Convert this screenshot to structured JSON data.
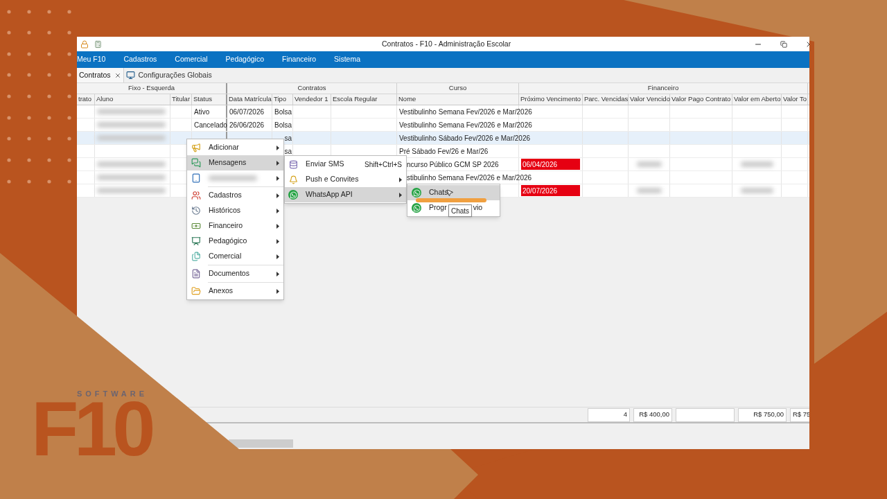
{
  "window": {
    "title": "Contratos - F10 - Administração Escolar"
  },
  "menu_bar": [
    "Meu F10",
    "Cadastros",
    "Comercial",
    "Pedagógico",
    "Financeiro",
    "Sistema"
  ],
  "tabs": [
    {
      "label": "Contratos",
      "selected": true,
      "closable": true
    },
    {
      "label": "Configurações Globais",
      "selected": false,
      "closable": false
    }
  ],
  "table": {
    "groups": [
      {
        "label": "Fixo - Esquerda",
        "columns": [
          "trato",
          "Aluno",
          "Titular",
          "Status"
        ]
      },
      {
        "label": "Contratos",
        "columns": [
          "Data Matrícula",
          "Tipo",
          "Vendedor 1",
          "Escola Regular"
        ]
      },
      {
        "label": "Curso",
        "columns": [
          "Nome"
        ]
      },
      {
        "label": "Financeiro",
        "columns": [
          "Próximo Vencimento",
          "Parc. Vencidas",
          "Valor Vencido",
          "Valor Pago Contrato",
          "Valor em Aberto",
          "Valor To"
        ]
      }
    ],
    "rows": [
      {
        "selected": false,
        "aluno_blurred": true,
        "status": "Ativo",
        "data_matricula": "06/07/2026",
        "tipo": "Bolsa",
        "nome": "Vestibulinho Semana Fev/2026 e Mar/2026"
      },
      {
        "selected": false,
        "aluno_blurred": true,
        "status": "Cancelado",
        "data_matricula": "26/06/2026",
        "tipo": "Bolsa",
        "nome": "Vestibulinho Semana Fev/2026 e Mar/2026"
      },
      {
        "selected": true,
        "aluno_blurred": true,
        "tipo": "sa",
        "tipo_cut": true,
        "nome": "Vestibulinho Sábado Fev/2026 e Mar/2026"
      },
      {
        "selected": false,
        "aluno_blurred": false,
        "tipo": "sa",
        "tipo_cut": true,
        "nome": "Pré Sábado Fev/26 e Mar/26"
      },
      {
        "selected": false,
        "aluno_blurred": true,
        "nome": "ncurso Público GCM SP 2026",
        "nome_cut": true,
        "proximo_vencimento": "06/04/2026",
        "overdue": true,
        "values_blurred": true
      },
      {
        "selected": false,
        "aluno_blurred": true,
        "nome": "stibulinho Semana Fev/2026 e Mar/2026",
        "nome_cut": true
      },
      {
        "selected": false,
        "aluno_blurred": true,
        "proximo_vencimento": "20/07/2026",
        "overdue": true,
        "values_blurred": true
      }
    ],
    "totals": [
      {
        "kind": "value",
        "text": "4"
      },
      {
        "kind": "value",
        "text": "R$ 400,00"
      },
      {
        "kind": "empty"
      },
      {
        "kind": "value",
        "text": "R$ 750,00"
      },
      {
        "kind": "value",
        "text": "R$ 75"
      }
    ]
  },
  "context_menu": {
    "items": [
      {
        "kind": "item",
        "label": "Adicionar",
        "selected": false,
        "divider_above": false
      },
      {
        "kind": "item",
        "label": "Mensagens",
        "selected": true,
        "divider_above": false
      },
      {
        "kind": "blurred",
        "selected": false,
        "divider_above": false
      },
      {
        "kind": "item",
        "label": "Cadastros",
        "selected": false,
        "divider_above": true
      },
      {
        "kind": "item",
        "label": "Históricos",
        "selected": false,
        "divider_above": false
      },
      {
        "kind": "item",
        "label": "Financeiro",
        "selected": false,
        "divider_above": false
      },
      {
        "kind": "item",
        "label": "Pedagógico",
        "selected": false,
        "divider_above": false
      },
      {
        "kind": "item",
        "label": "Comercial",
        "selected": false,
        "divider_above": false
      },
      {
        "kind": "item",
        "label": "Documentos",
        "selected": false,
        "divider_above": true
      },
      {
        "kind": "item",
        "label": "Anexos",
        "selected": false,
        "divider_above": true
      }
    ]
  },
  "submenu": {
    "items": [
      {
        "label": "Enviar SMS",
        "shortcut": "Shift+Ctrl+S",
        "has_submenu": false,
        "selected": false
      },
      {
        "label": "Push e Convites",
        "has_submenu": true,
        "selected": false
      },
      {
        "label": "WhatsApp API",
        "has_submenu": true,
        "selected": true
      }
    ]
  },
  "whatsapp_menu": {
    "items": [
      {
        "label": "Chats",
        "selected": true
      },
      {
        "label": "Progr",
        "label_end": "vio",
        "selected": false
      }
    ]
  },
  "tooltip": "Chats",
  "brand": {
    "name": "F10",
    "tagline": "SOFTWARE"
  }
}
